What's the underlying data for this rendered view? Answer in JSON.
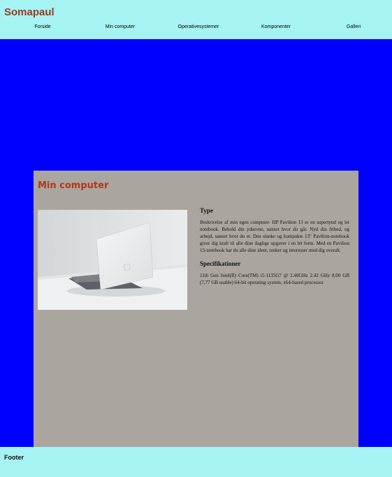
{
  "header": {
    "site_title": "Somapaul",
    "nav": [
      "Forside",
      "Min computer",
      "Operativesystemer",
      "Komponenter",
      "Galleri"
    ]
  },
  "main": {
    "title": "Min computer",
    "image_alt": "laptop-photo",
    "type_heading": "Type",
    "type_text": "Beskrivelse af min egen computer- HP Pavilion 13 er en supertynd og let notebook. Behold din ydeevne, uanset hvor du går. Nyd din frihed, og arbejd, uanset hvor du er. Den slanke og kompakte 13\" Pavilion-notebook giver dig kraft til alle dine daglige opgaver i en let form. Med en Pavilion 13-notebook har du alle dine ideer, tanker og interesser med dig overalt.",
    "spec_heading": "Specifikationer",
    "spec_text": "11th Gen Intel(R) Core(TM) i5-1135G7 @ 2.40GHz 2.42 GHz 8,00 GB (7,77 GB usable) 64-bit operating system, x64-based processor"
  },
  "footer": {
    "text": "Footer"
  },
  "colors": {
    "header_bg": "#a6f3f3",
    "page_bg": "#0000ff",
    "panel_bg": "#aaa69f",
    "title_color": "#9a3a1e"
  }
}
